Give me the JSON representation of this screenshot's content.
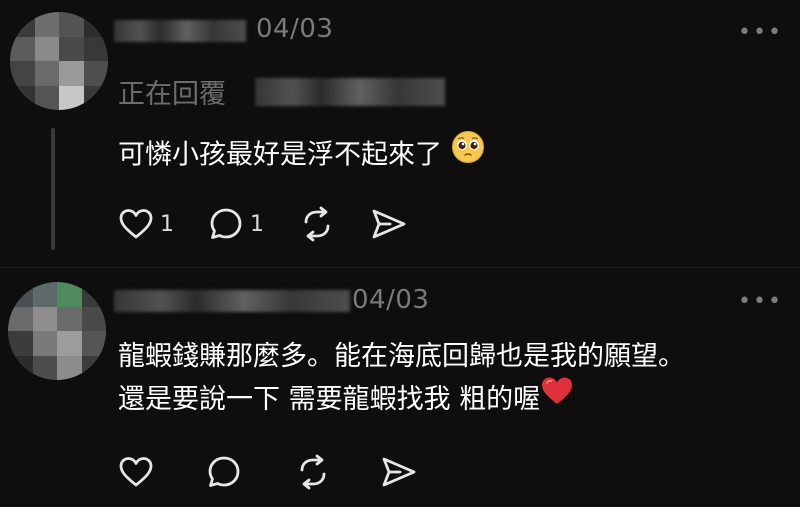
{
  "comment1": {
    "date": "04/03",
    "more": "•••",
    "replying_label": "正在回覆",
    "text": "可憐小孩最好是浮不起來了",
    "emoji": "pleading-face",
    "likes": "1",
    "replies": "1"
  },
  "comment2": {
    "date": "04/03",
    "more": "•••",
    "line1": "龍蝦錢賺那麼多。能在海底回歸也是我的願望。",
    "line2": "還是要說一下 需要龍蝦找我 粗的喔",
    "emoji": "red-heart"
  },
  "colors": {
    "background": "#0e0e0e",
    "muted_text": "#7a7a7a",
    "heart": "#e0313a"
  }
}
